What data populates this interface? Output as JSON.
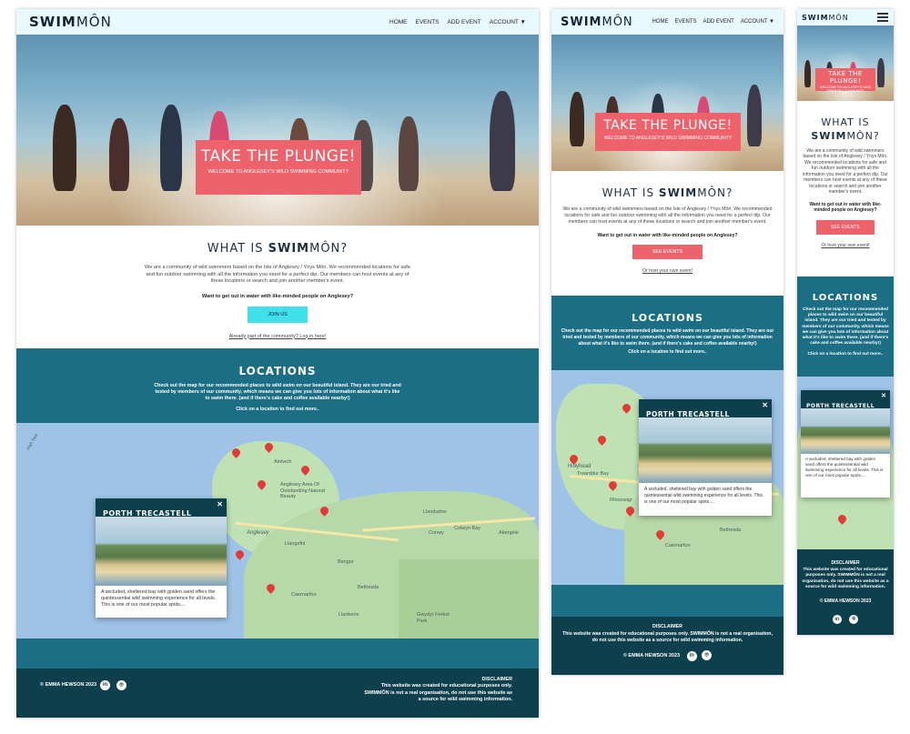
{
  "brand": {
    "bold": "SWIM",
    "rest": "MÔN"
  },
  "nav": {
    "home": "HOME",
    "events": "EVENTS",
    "add_event": "ADD EVENT",
    "account": "ACCOUNT ▼"
  },
  "hero": {
    "title": "TAKE THE PLUNGE!",
    "subtitle": "WELCOME TO ANGLESEY'S WILD SWIMMING COMMUNITY"
  },
  "about": {
    "heading_pre": "WHAT IS",
    "desc_desktop": "We are a community of wild swimmers based on the Isle of Anglesey / Ynys Môn. We recommended locations for safe and fun outdoor swimming with all the information you need for a perfect dip. Our members can host events at any of these locations or search and join another member's event.",
    "cta_q": "Want to get out in water with like-minded people on Anglesey?",
    "join_btn": "JOIN US",
    "login_text": "Already part of the community? Log in here!",
    "events_btn": "SEE EVENTS",
    "host_link": "Or host your own event!"
  },
  "locations": {
    "title": "LOCATIONS",
    "desc": "Check out the map for our recommended places to wild swim on our beautiful island. They are our tried and tested by members of our community, which means we can give you lots of information about what it's like to swim there. (and if there's cake and coffee available nearby!)",
    "click_hint": "Click on a location to find out more.."
  },
  "popup": {
    "title": "PORTH TRECASTELL",
    "close": "✕",
    "desc": "A secluded, sheltered bay with golden sand offers the quintessential wild swimming experience for all levels. This is one of our most popular spots...."
  },
  "map_labels": {
    "amlwch": "Amlwch",
    "anglesey_aonb": "Anglesey Area Of Outstanding Natural Beauty",
    "anglesey": "Anglesey",
    "llangefni": "Llangefni",
    "llandudno": "Llandudno",
    "conwy": "Conwy",
    "colwyn_bay": "Colwyn Bay",
    "abergele": "Abergele",
    "bangor": "Bangor",
    "bethesda": "Bethesda",
    "caernarfon": "Caernarfon",
    "llanberis": "Llanberis",
    "gwydir": "Gwydyr Forest Park",
    "holyhead": "Holyhead",
    "trearddur": "Trearddur Bay",
    "rhosneigr": "Rhosneigr",
    "irish_sea": "Irish Sea"
  },
  "footer": {
    "copyright": "© EMMA HEWSON 2023",
    "disclaimer_title": "DISCLAIMER",
    "disclaimer_text": "This website was created for educational purposes only. SWIMMÔN is not a real organisation, do not use this website as a source for wild swimming information.",
    "linkedin": "in",
    "github": "⌾"
  },
  "colors": {
    "accent_pink": "#ee636b",
    "accent_cyan": "#40e0ea",
    "teal": "#1c6e85",
    "dark_teal": "#0d3f4d",
    "nav_bg": "#e8f9ff"
  }
}
